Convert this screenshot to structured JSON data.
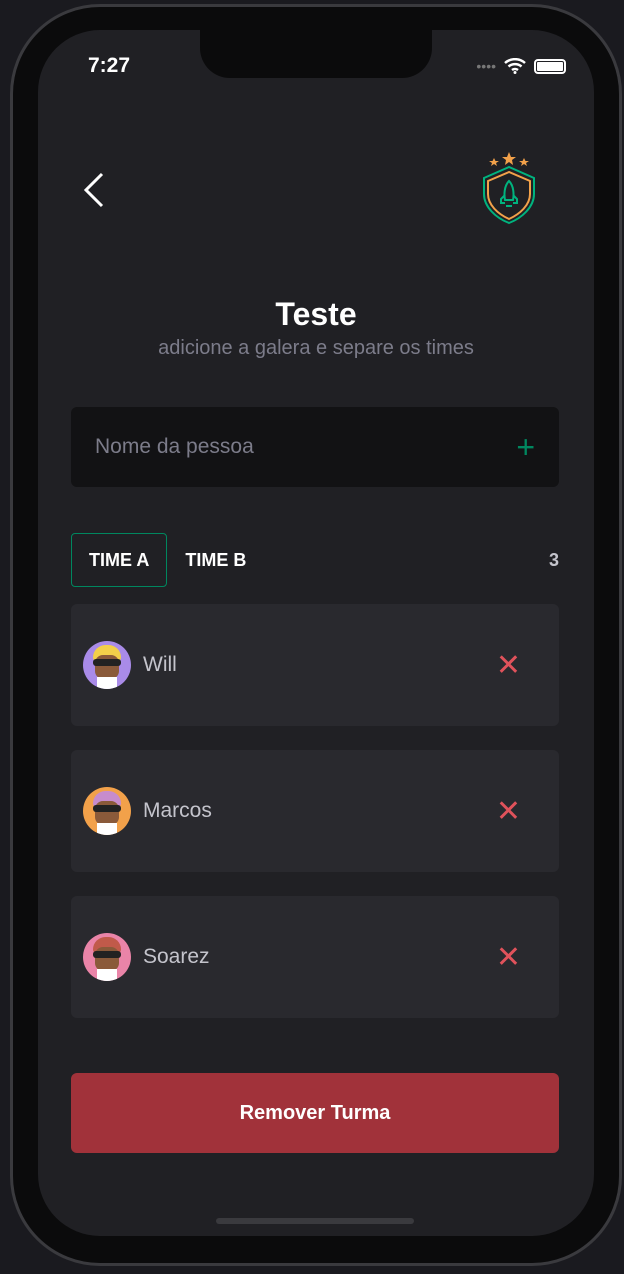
{
  "status": {
    "time": "7:27"
  },
  "header": {
    "title": "Teste",
    "subtitle": "adicione a galera e separe os times"
  },
  "input": {
    "placeholder": "Nome da pessoa"
  },
  "tabs": [
    {
      "label": "TIME A",
      "active": true
    },
    {
      "label": "TIME B",
      "active": false
    }
  ],
  "count": "3",
  "players": [
    {
      "name": "Will",
      "avatar_bg": "#a98be8",
      "hair": "#f2cf4a"
    },
    {
      "name": "Marcos",
      "avatar_bg": "#f2a14a",
      "hair": "#c78ccc"
    },
    {
      "name": "Soarez",
      "avatar_bg": "#ea84a8",
      "hair": "#c15a4a"
    }
  ],
  "button": {
    "label": "Remover Turma"
  },
  "colors": {
    "accent": "#00875f",
    "danger": "#a1323a",
    "remove": "#e0525b"
  }
}
